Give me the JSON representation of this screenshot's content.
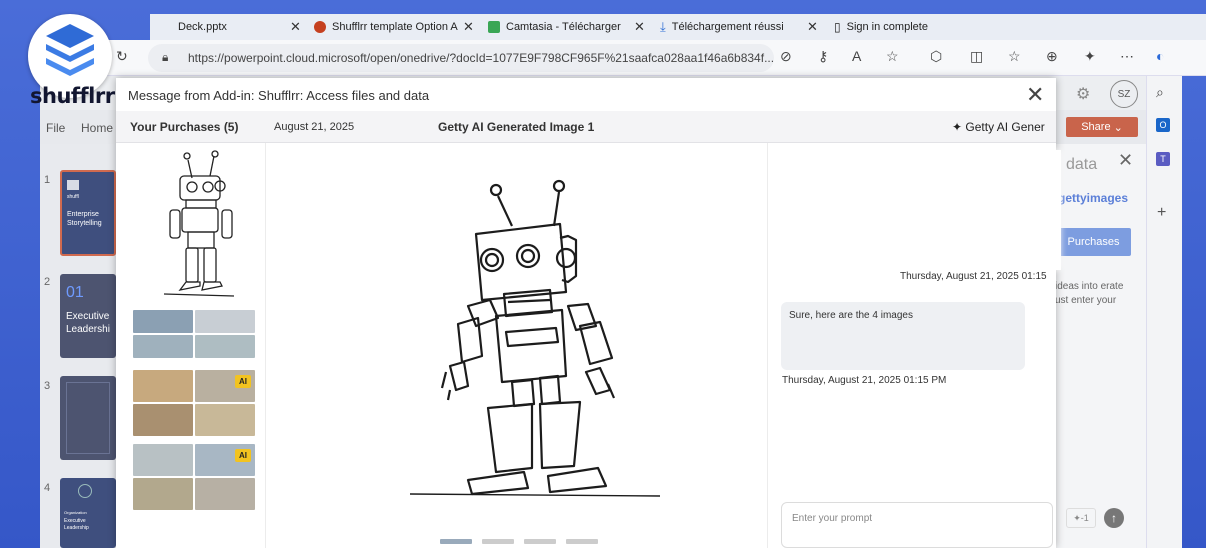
{
  "browser": {
    "tabs": [
      {
        "label": "Deck.pptx",
        "close": "✕"
      },
      {
        "label": "Shufflrr template Option A",
        "close": "✕"
      },
      {
        "label": "Camtasia - Télécharger",
        "close": "✕"
      },
      {
        "label": "Téléchargement réussi",
        "close": "✕"
      },
      {
        "label": "Sign in complete",
        "close": ""
      }
    ],
    "url": "https://powerpoint.cloud.microsoft/open/onedrive/?docId=1077E9F798CF965F%21saafca028aa1f46a6b834f..."
  },
  "brand": {
    "logo_text": "shufflrr"
  },
  "ppt": {
    "ribbon": [
      "File",
      "Home"
    ],
    "slides": [
      {
        "num": "1",
        "title": "Enterprise Storytelling",
        "small": "shuffl"
      },
      {
        "num": "2",
        "big": "01",
        "title": "Executive Leadershi"
      },
      {
        "num": "3"
      },
      {
        "num": "4",
        "title": "Executive Leadership",
        "small": "Organization"
      }
    ],
    "share_label": "Share",
    "user_initials": "SZ",
    "right_pane": {
      "title": "data",
      "brand": "gettyimages",
      "btn": "Purchases",
      "text": "ideas into erate ust enter your"
    }
  },
  "modal": {
    "title": "Message from Add-in: Shufflrr: Access files and data",
    "close": "✕",
    "purchases": "Your Purchases (5)",
    "date": "August 21, 2025",
    "image_title": "Getty AI Generated Image 1",
    "getty_btn": "Getty AI Gener",
    "badge": "AI",
    "chat": {
      "ts1": "Thursday, August 21, 2025 01:15",
      "bubble": "Sure, here are the 4 images",
      "ts2": "Thursday, August 21, 2025 01:15 PM",
      "prompt_placeholder": "Enter your prompt"
    }
  },
  "colors": {
    "accent": "#c9644b",
    "brand": "#3557c8",
    "getty": "#5b7fd8"
  }
}
